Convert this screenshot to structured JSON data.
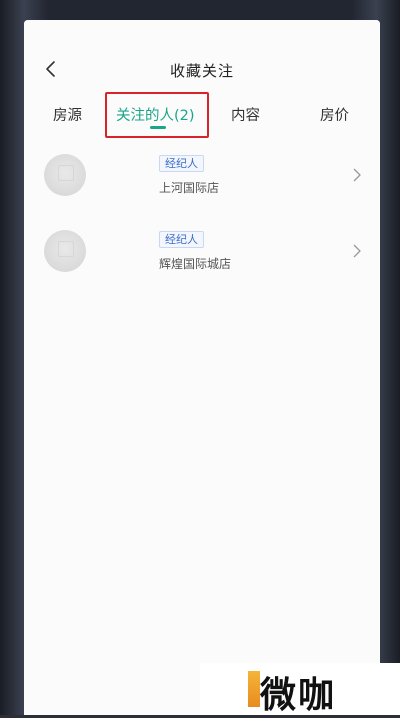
{
  "header": {
    "title": "收藏关注"
  },
  "tabs": [
    {
      "label": "房源"
    },
    {
      "label": "关注的人(2)",
      "active": true
    },
    {
      "label": "内容"
    },
    {
      "label": "房价"
    }
  ],
  "agents": [
    {
      "badge": "经纪人",
      "store": "上河国际店"
    },
    {
      "badge": "经纪人",
      "store": "辉煌国际城店"
    }
  ],
  "watermark": {
    "text": "微咖"
  },
  "colors": {
    "accent": "#1aa589",
    "highlight": "#d8232a",
    "badge": "#3a6cc7"
  }
}
